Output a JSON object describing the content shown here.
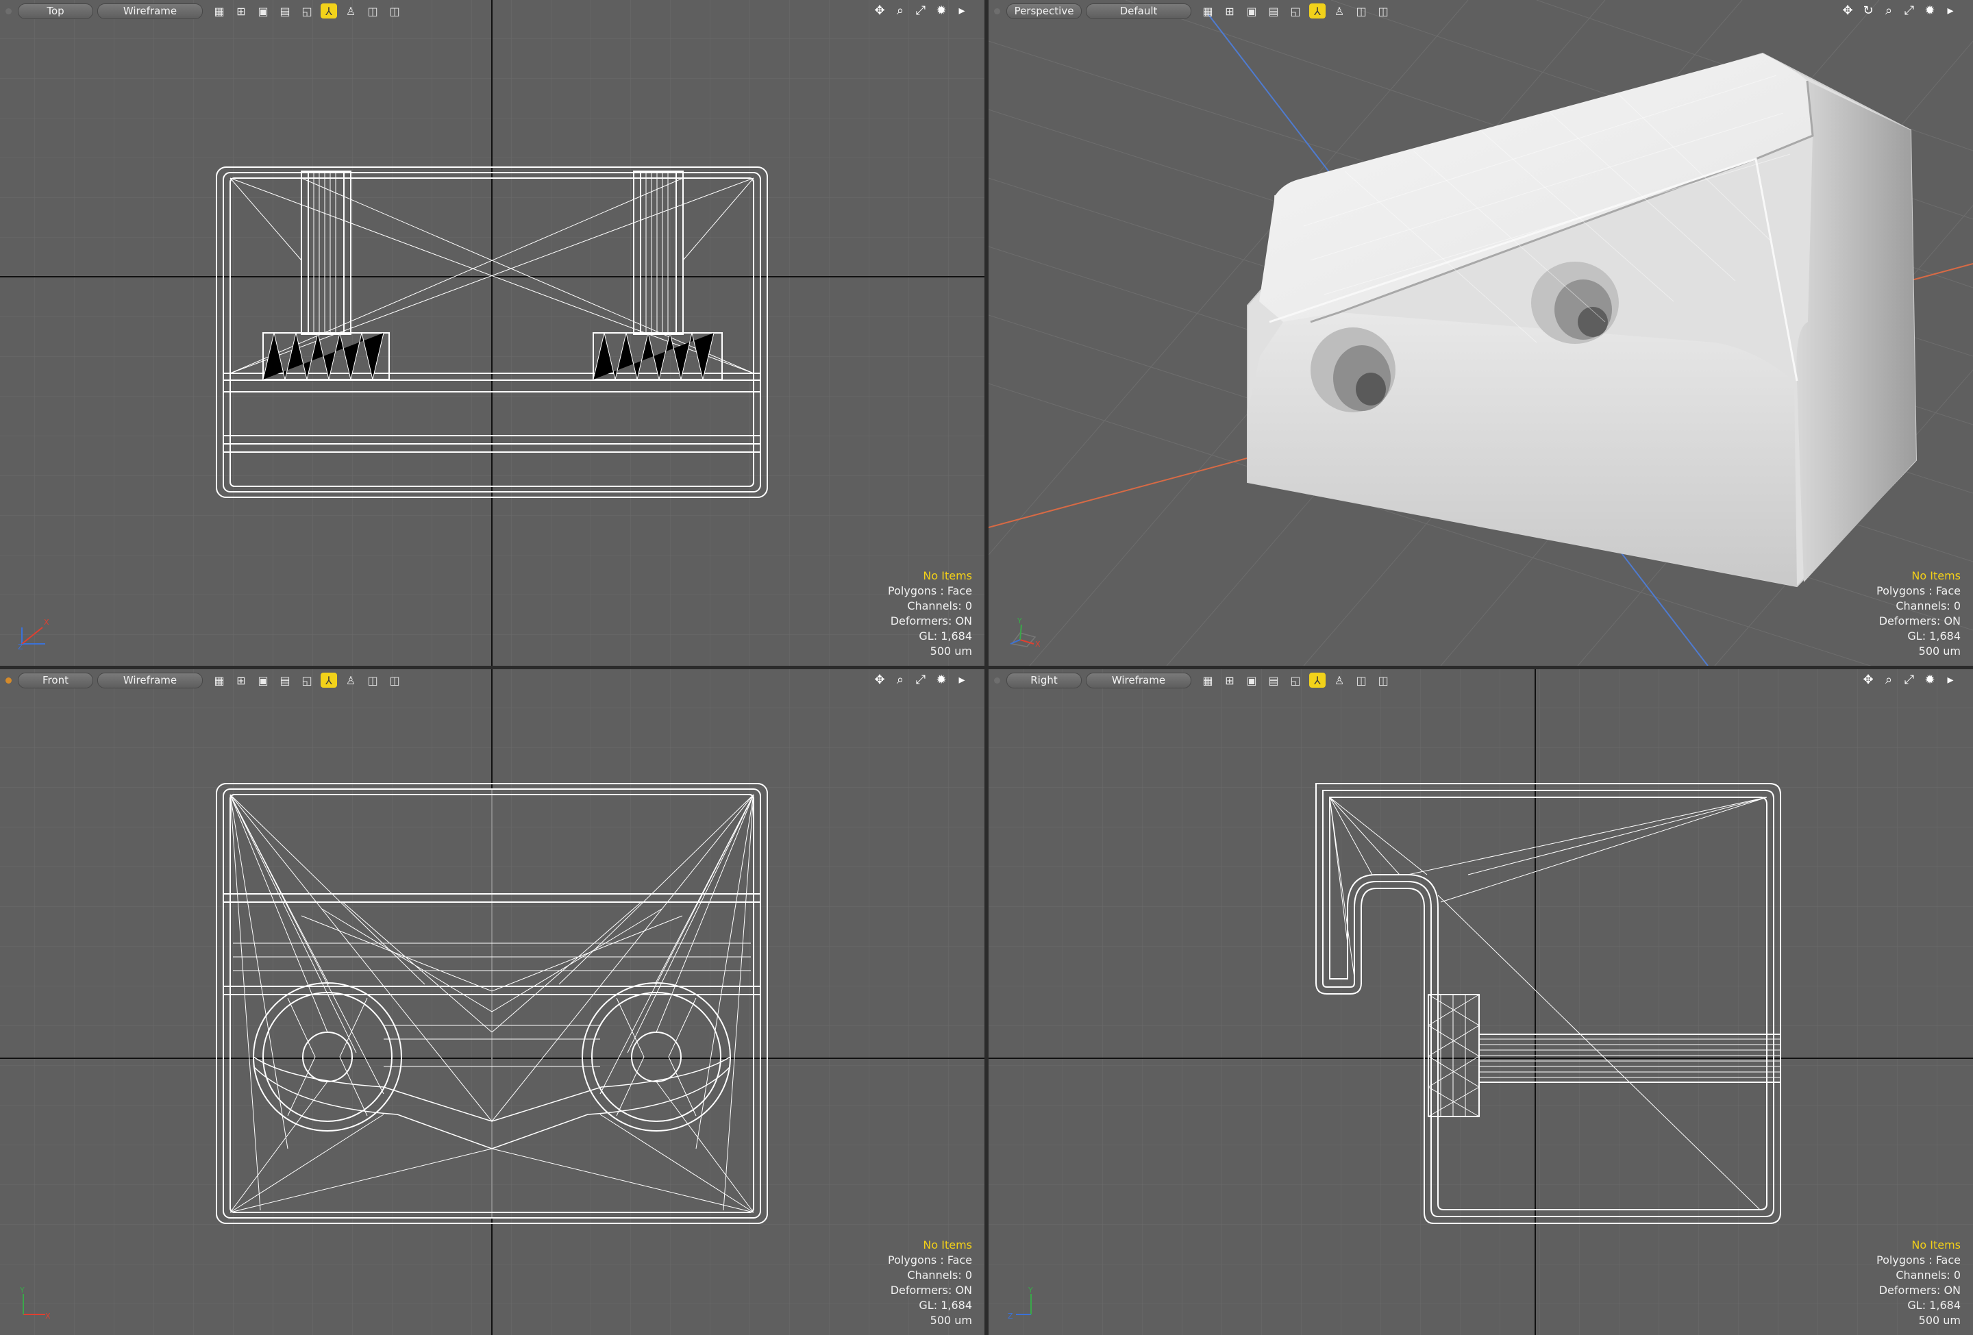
{
  "viewports": {
    "top": {
      "name": "Top",
      "mode": "Wireframe"
    },
    "persp": {
      "name": "Perspective",
      "mode": "Default"
    },
    "front": {
      "name": "Front",
      "mode": "Wireframe"
    },
    "right": {
      "name": "Right",
      "mode": "Wireframe"
    }
  },
  "info": {
    "no_items": "No Items",
    "polygons": "Polygons : Face",
    "channels": "Channels: 0",
    "deformers": "Deformers: ON",
    "gl": "GL: 1,684",
    "scale": "500 um"
  },
  "axes": {
    "x": "X",
    "y": "Y",
    "z": "Z"
  },
  "toolbar_icons": [
    "grid-icon",
    "quad-icon",
    "square-icon",
    "lines-icon",
    "axis-icon",
    "person-icon",
    "box-icon",
    "layers-icon"
  ],
  "nav_icons": [
    "move-icon",
    "rotate-icon",
    "zoom-icon",
    "fit-icon",
    "settings-icon",
    "arrow-icon"
  ],
  "colors": {
    "viewport_bg": "#5f5f5f",
    "active_tool": "#f2d21a",
    "highlight_text": "#f3d018",
    "axis_x": "#e0663c",
    "axis_z": "#4d7fd6"
  }
}
